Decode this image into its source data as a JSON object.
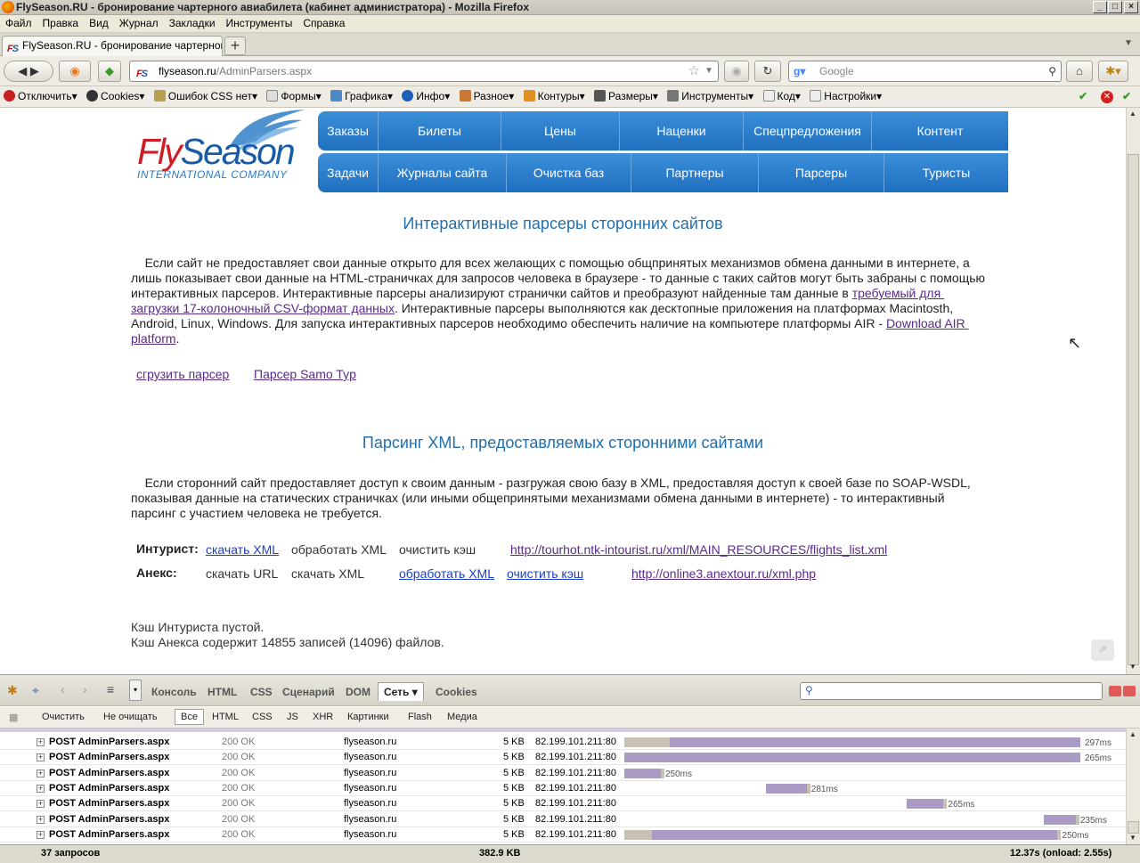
{
  "window": {
    "title": "FlySeason.RU - бронирование чартерного авиабилета (кабинет администратора) - Mozilla Firefox"
  },
  "menu": [
    "Файл",
    "Правка",
    "Вид",
    "Журнал",
    "Закладки",
    "Инструменты",
    "Справка"
  ],
  "tab": {
    "label": "FlySeason.RU - бронирование чартерного ..."
  },
  "address": {
    "host": "flyseason.ru",
    "path": "/AdminParsers.aspx"
  },
  "search": {
    "placeholder": "Google"
  },
  "webdev": [
    "Отключить",
    "Cookies",
    "Ошибок CSS нет",
    "Формы",
    "Графика",
    "Инфо",
    "Разное",
    "Контуры",
    "Размеры",
    "Инструменты",
    "Код",
    "Настройки"
  ],
  "logo": {
    "fly": "Fly",
    "season": "Season",
    "sub": "INTERNATIONAL COMPANY"
  },
  "nav_row1": [
    "Заказы",
    "Билеты",
    "Цены",
    "Наценки",
    "Спецпредложения",
    "Контент"
  ],
  "nav_row2": [
    "Задачи",
    "Журналы сайта",
    "Очистка баз",
    "Партнеры",
    "Парсеры",
    "Туристы"
  ],
  "section1": {
    "title": "Интерактивные парсеры сторонних сайтов",
    "p_a": "    Если сайт не предоставляет свои данные открыто для всех желающих с помощью общпринятых механизмов обмена данными в интернете, а лишь показывает свои данные на HTML-страничках для запросов человека в браузере - то данные с таких сайтов могут быть забраны с помощью интерактивных парсеров. Интерактивные парсеры анализируют странички сайтов и преобразуют найденные там данные в ",
    "p_link1": "требуемый для загрузки 17-колоночный CSV-формат данных",
    "p_b": ". Интерактивные парсеры выполняются как десктопные приложения на платформах Macintosth, Android, Linux, Windows. Для запуска интерактивных парсеров необходимо обеспечить наличие на компьютере платформы AIR - ",
    "p_link2": "Download AIR platform",
    "p_c": ".",
    "link_download": "сгрузить парсер",
    "link_samo": "Парсер Samo Typ"
  },
  "section2": {
    "title": "Парсинг XML, предоставляемых сторонними сайтами",
    "para": "    Если сторонний сайт предоставляет доступ к своим данным - разгружая свою базу в XML, предоставляя доступ к своей базе по SOAP-WSDL, показывая данные на статических страничках (или иными общепринятыми механизмами обмена данными в интернете) - то интерактивный парсинг с участием человека не требуется.",
    "intourist": {
      "label": "Интурист:",
      "download": "скачать XML",
      "process": "обработать XML",
      "clear": "очистить кэш",
      "url": "http://tourhot.ntk-intourist.ru/xml/MAIN_RESOURCES/flights_list.xml"
    },
    "anex": {
      "label": "Анекс:",
      "download_url": "скачать URL",
      "download_xml": "скачать XML",
      "process": "обработать XML",
      "clear": "очистить кэш",
      "url": "http://online3.anextour.ru/xml.php"
    },
    "status1": "Кэш Интуриста пустой.",
    "status2": "Кэш Анекса содержит 14855 записей (14096) файлов."
  },
  "firebug": {
    "tabs": [
      "Консоль",
      "HTML",
      "CSS",
      "Сценарий",
      "DOM",
      "Сеть",
      "Cookies"
    ],
    "selected_tab": "Сеть",
    "filters": [
      "Очистить",
      "Не очищать",
      "Все",
      "HTML",
      "CSS",
      "JS",
      "XHR",
      "Картинки",
      "Flash",
      "Медиа"
    ],
    "rows": [
      {
        "method": "POST AdminParsers.aspx",
        "status": "200 OK",
        "domain": "flyseason.ru",
        "size": "5 KB",
        "ip": "82.199.101.211:80",
        "time": "297ms",
        "wait_start": 0.0,
        "wait_end": 0.1,
        "end": 1.0
      },
      {
        "method": "POST AdminParsers.aspx",
        "status": "200 OK",
        "domain": "flyseason.ru",
        "size": "5 KB",
        "ip": "82.199.101.211:80",
        "time": "265ms",
        "wait_start": 0.0,
        "wait_end": 0.0,
        "end": 1.0
      },
      {
        "method": "POST AdminParsers.aspx",
        "status": "200 OK",
        "domain": "flyseason.ru",
        "size": "5 KB",
        "ip": "82.199.101.211:80",
        "time": "250ms",
        "wait_start": 0.0,
        "wait_end": 0.0,
        "end": 0.08
      },
      {
        "method": "POST AdminParsers.aspx",
        "status": "200 OK",
        "domain": "flyseason.ru",
        "size": "5 KB",
        "ip": "82.199.101.211:80",
        "time": "281ms",
        "wait_start": 0.31,
        "wait_end": 0.31,
        "end": 0.4
      },
      {
        "method": "POST AdminParsers.aspx",
        "status": "200 OK",
        "domain": "flyseason.ru",
        "size": "5 KB",
        "ip": "82.199.101.211:80",
        "time": "265ms",
        "wait_start": 0.62,
        "wait_end": 0.62,
        "end": 0.7
      },
      {
        "method": "POST AdminParsers.aspx",
        "status": "200 OK",
        "domain": "flyseason.ru",
        "size": "5 KB",
        "ip": "82.199.101.211:80",
        "time": "235ms",
        "wait_start": 0.92,
        "wait_end": 0.92,
        "end": 0.99
      },
      {
        "method": "POST AdminParsers.aspx",
        "status": "200 OK",
        "domain": "flyseason.ru",
        "size": "5 KB",
        "ip": "82.199.101.211:80",
        "time": "250ms",
        "wait_start": 0.0,
        "wait_end": 0.06,
        "end": 0.95
      }
    ],
    "footer": {
      "count": "37 запросов",
      "total_size": "382.9 KB",
      "total_time": "12.37s (onload: 2.55s)"
    }
  }
}
